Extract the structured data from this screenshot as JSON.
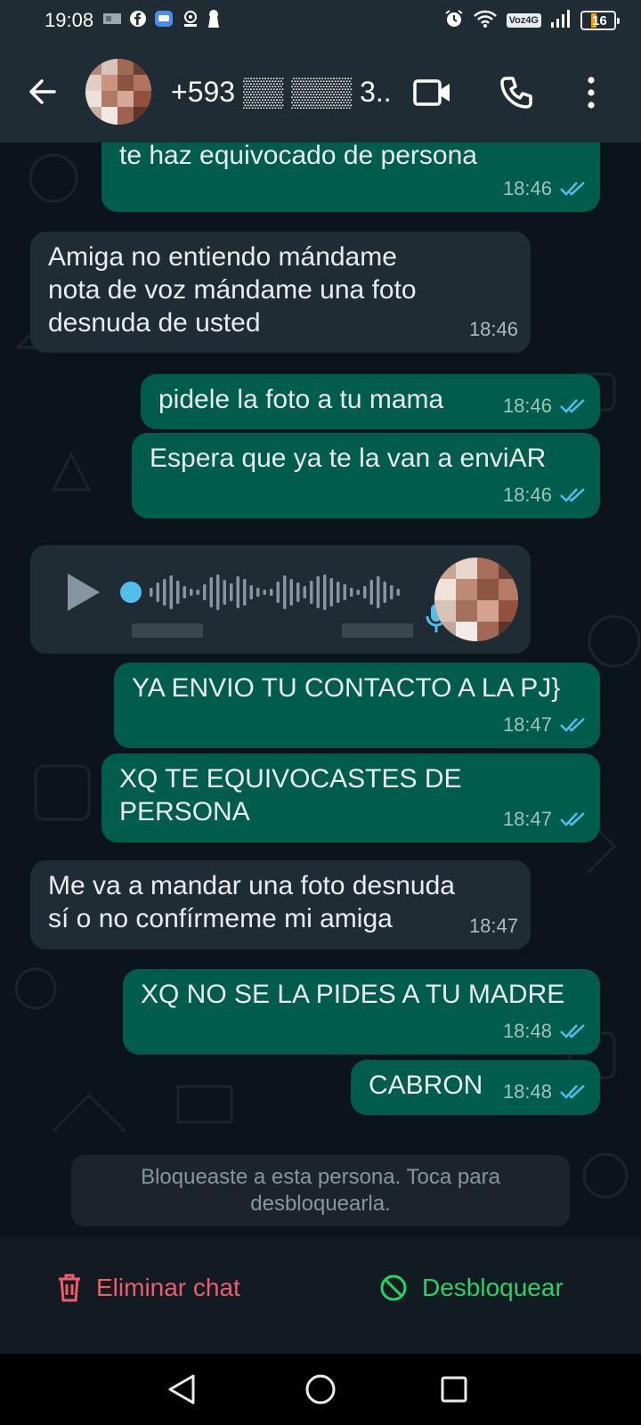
{
  "status_bar": {
    "time": "19:08",
    "network_label": "Voz4G",
    "battery": "16",
    "icons": [
      "gallery-icon",
      "facebook-icon",
      "message-icon",
      "webcam-icon",
      "keyhole-icon",
      "alarm-icon",
      "wifi-icon",
      "signal-icon",
      "battery-icon"
    ]
  },
  "header": {
    "contact_name": "+593 ▒▒ ▒▒▒ 3...",
    "icons": [
      "back-arrow-icon",
      "video-call-icon",
      "phone-icon",
      "more-vertical-icon"
    ]
  },
  "messages": [
    {
      "dir": "out",
      "text": "te haz equivocado de persona",
      "time": "18:46"
    },
    {
      "dir": "in",
      "text": "Amiga no entiendo mándame\nnota de voz mándame una foto\ndesnuda de usted",
      "time": "18:46"
    },
    {
      "dir": "out",
      "text": "pidele la foto a tu mama",
      "time": "18:46"
    },
    {
      "dir": "out",
      "text": "Espera que ya te la van a enviAR",
      "time": "18:46"
    },
    {
      "dir": "out",
      "text": "YA ENVIO TU CONTACTO A LA PJ}",
      "time": "18:47"
    },
    {
      "dir": "out",
      "text": "XQ TE EQUIVOCASTES DE\nPERSONA",
      "time": "18:47"
    },
    {
      "dir": "in",
      "text": "Me va a mandar una foto desnuda\nsí o no confírmeme mi amiga",
      "time": "18:47"
    },
    {
      "dir": "out",
      "text": "XQ NO SE LA PIDES A TU MADRE",
      "time": "18:48"
    },
    {
      "dir": "out",
      "text": "CABRON",
      "time": "18:48"
    }
  ],
  "voice_note": {
    "played_fraction": 0.0
  },
  "blocked_notice": "Bloqueaste a esta persona. Toca para desbloquearla.",
  "actions": {
    "delete_label": "Eliminar chat",
    "unblock_label": "Desbloquear"
  },
  "colors": {
    "outgoing": "#005c4b",
    "incoming": "#1f2c34",
    "read_tick": "#53bdeb",
    "delete": "#f15c6d",
    "unblock": "#25d366"
  }
}
